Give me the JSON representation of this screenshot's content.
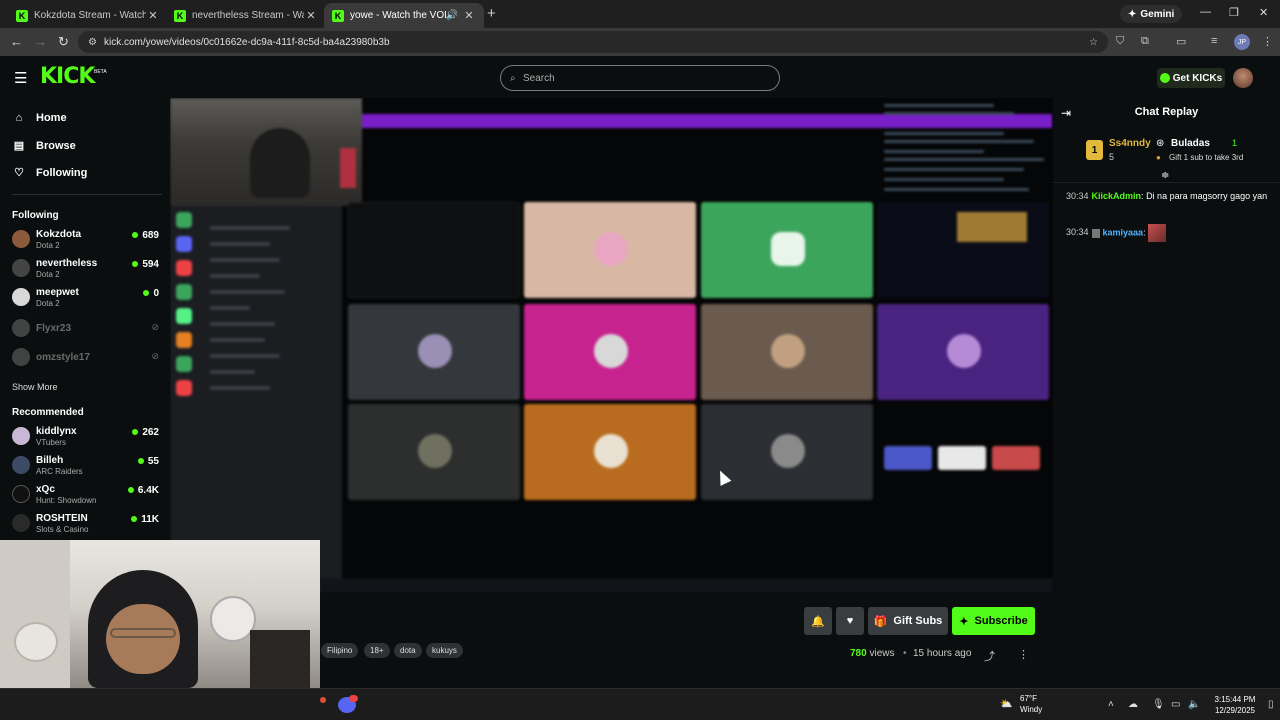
{
  "browser": {
    "tabs": [
      {
        "title": "Kokzdota Stream - Watch Live o",
        "active": false
      },
      {
        "title": "nevertheless Stream - Watch Liv",
        "active": false
      },
      {
        "title": "yowe - Watch the VOD on K",
        "active": true
      }
    ],
    "new_tab": "+",
    "gemini_label": "Gemini",
    "url": "kick.com/yowe/videos/0c01662e-dc9a-411f-8c5d-ba4a23980b3b",
    "profile_initials": "JP"
  },
  "header": {
    "logo": "KICK",
    "beta": "BETA",
    "search_placeholder": "Search",
    "get_kicks": "Get KICKs"
  },
  "sidebar": {
    "nav": [
      {
        "label": "Home",
        "icon": "home-icon"
      },
      {
        "label": "Browse",
        "icon": "browse-icon"
      },
      {
        "label": "Following",
        "icon": "heart-icon"
      }
    ],
    "following_header": "Following",
    "following": [
      {
        "name": "Kokzdota",
        "category": "Dota 2",
        "viewers": "689",
        "live": true
      },
      {
        "name": "nevertheless",
        "category": "Dota 2",
        "viewers": "594",
        "live": true
      },
      {
        "name": "meepwet",
        "category": "Dota 2",
        "viewers": "0",
        "live": true
      },
      {
        "name": "Flyxr23",
        "category": "",
        "viewers": "",
        "live": false
      },
      {
        "name": "omzstyle17",
        "category": "",
        "viewers": "",
        "live": false
      }
    ],
    "show_more": "Show More",
    "recommended_header": "Recommended",
    "recommended": [
      {
        "name": "kiddlynx",
        "category": "VTubers",
        "viewers": "262"
      },
      {
        "name": "Billeh",
        "category": "ARC Raiders",
        "viewers": "55"
      },
      {
        "name": "xQc",
        "category": "Hunt: Showdown",
        "viewers": "6.4K"
      },
      {
        "name": "ROSHTEIN",
        "category": "Slots & Casino",
        "viewers": "11K"
      }
    ]
  },
  "video_actions": {
    "gift_subs": "Gift Subs",
    "subscribe": "Subscribe",
    "tags": [
      "Filipino",
      "18+",
      "dota",
      "kukuys"
    ],
    "views_count": "780",
    "views_label": "views",
    "separator": "•",
    "age": "15 hours ago"
  },
  "chat": {
    "title": "Chat Replay",
    "pinned": {
      "user1": "Ss4nndy",
      "user1_count": "5",
      "user2": "Buladas",
      "user2_count": "1",
      "note": "Gift 1 sub to take 3rd"
    },
    "messages": [
      {
        "time": "30:34",
        "user": "KiickAdmin",
        "text": "Di na para magsorry gago yan"
      },
      {
        "time": "30:34",
        "user": "kamiyaaa",
        "text": ""
      }
    ]
  },
  "taskbar": {
    "temp": "67°F",
    "weather": "Windy",
    "time": "3:15:44 PM",
    "date": "12/29/2025"
  }
}
